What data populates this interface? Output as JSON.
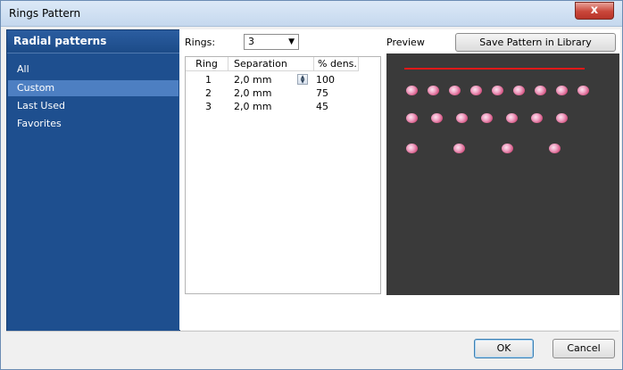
{
  "window": {
    "title": "Rings Pattern",
    "close_label": "x"
  },
  "sidebar": {
    "header": "Radial patterns",
    "items": [
      {
        "label": "All",
        "selected": false
      },
      {
        "label": "Custom",
        "selected": true
      },
      {
        "label": "Last Used",
        "selected": false
      },
      {
        "label": "Favorites",
        "selected": false
      }
    ]
  },
  "rings": {
    "label": "Rings:",
    "value": "3"
  },
  "preview": {
    "label": "Preview",
    "save_button": "Save Pattern in Library"
  },
  "table": {
    "columns": [
      "Ring",
      "Separation",
      "% dens."
    ],
    "rows": [
      {
        "ring": "1",
        "separation": "2,0 mm",
        "density": "100"
      },
      {
        "ring": "2",
        "separation": "2,0 mm",
        "density": "75"
      },
      {
        "ring": "3",
        "separation": "2,0 mm",
        "density": "45"
      }
    ]
  },
  "preview_rows": [
    {
      "count": 9
    },
    {
      "count": 7
    },
    {
      "count": 4
    }
  ],
  "colors": {
    "preview_bg": "#3a3a3a",
    "line": "#e01818",
    "gem": "#e06a98",
    "sidebar": "#1e4f8f"
  },
  "footer": {
    "ok": "OK",
    "cancel": "Cancel"
  }
}
